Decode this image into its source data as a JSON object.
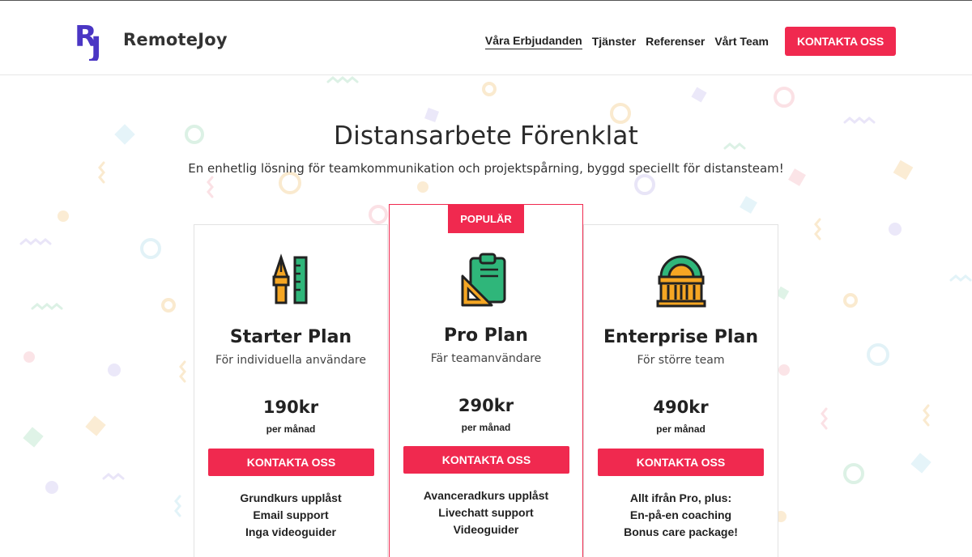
{
  "brand": {
    "name": "RemoteJoy",
    "mark": "RJ",
    "primary_color": "#4a36c4",
    "accent_color": "#f0294f"
  },
  "nav": {
    "links": [
      {
        "label": "Våra Erbjudanden",
        "active": true
      },
      {
        "label": "Tjänster",
        "active": false
      },
      {
        "label": "Referenser",
        "active": false
      },
      {
        "label": "Vårt Team",
        "active": false
      }
    ],
    "cta_label": "KONTAKTA OSS"
  },
  "hero": {
    "title": "Distansarbete Förenklat",
    "subtitle": "En enhetlig lösning för teamkommunikation och projektspårning, byggd speciellt för distansteam!"
  },
  "plans": [
    {
      "icon": "pen-and-ruler-icon",
      "name": "Starter Plan",
      "description": "För individuella användare",
      "price": "190kr",
      "period": "per månad",
      "button_label": "KONTAKTA OSS",
      "features": [
        "Grundkurs upplåst",
        "Email support",
        "Inga videoguider"
      ],
      "popular": false
    },
    {
      "icon": "clipboard-icon",
      "name": "Pro Plan",
      "description": "Fär teamanvändare",
      "price": "290kr",
      "period": "per månad",
      "button_label": "KONTAKTA OSS",
      "features": [
        "Avanceradkurs upplåst",
        "Livechatt support",
        "Videoguider"
      ],
      "popular": true,
      "badge": "POPULÄR"
    },
    {
      "icon": "building-icon",
      "name": "Enterprise Plan",
      "description": "För större team",
      "price": "490kr",
      "period": "per månad",
      "button_label": "KONTAKTA OSS",
      "features": [
        "Allt ifrån Pro, plus:",
        "En-på-en coaching",
        "Bonus care package!"
      ],
      "popular": false
    }
  ]
}
